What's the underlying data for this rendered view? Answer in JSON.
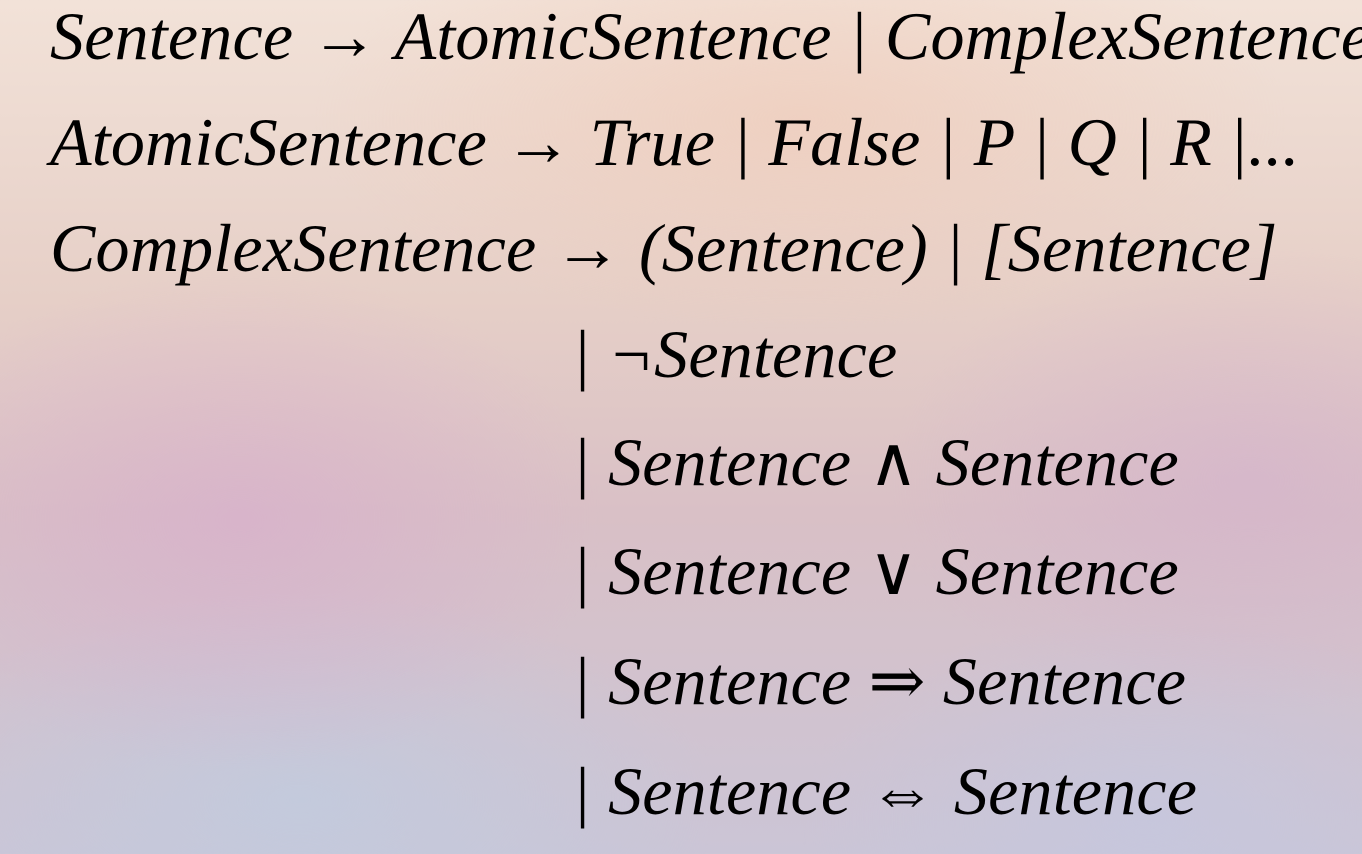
{
  "grammar": {
    "rules": [
      {
        "text": "Sentence → AtomicSentence | ComplexSentence"
      },
      {
        "text": "AtomicSentence → True | False | P | Q | R |..."
      },
      {
        "text": "ComplexSentence → (Sentence) | [Sentence]"
      },
      {
        "text": "| ¬Sentence"
      },
      {
        "text": "| Sentence ∧ Sentence"
      },
      {
        "text": "| Sentence ∨ Sentence"
      },
      {
        "text": "| Sentence ⇒ Sentence"
      },
      {
        "text": "| Sentence ⇔ Sentence"
      }
    ]
  }
}
